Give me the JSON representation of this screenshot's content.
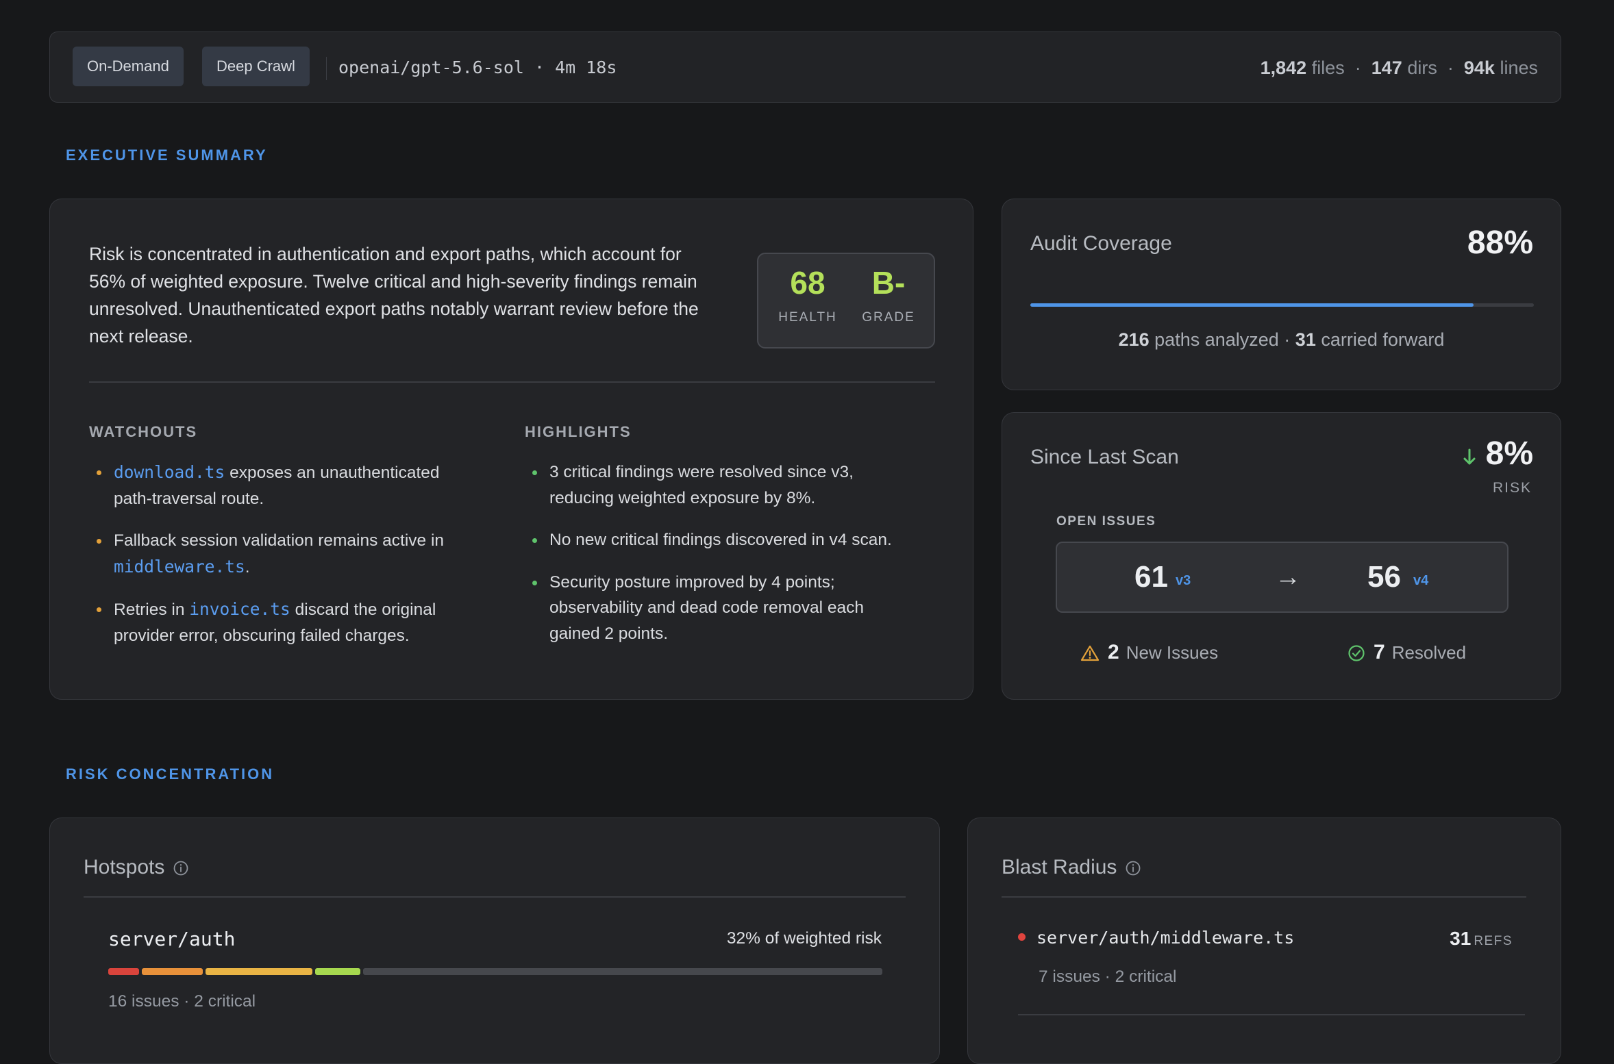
{
  "topbar": {
    "pill_1": "On-Demand",
    "pill_2": "Deep Crawl",
    "model": "openai/gpt-5.6-sol · 4m 18s",
    "files_count": "1,842",
    "files_label": "files",
    "dirs_count": "147",
    "dirs_label": "dirs",
    "lines_count": "94k",
    "lines_label": "lines",
    "separator": "·"
  },
  "sections": {
    "executive": "EXECUTIVE SUMMARY",
    "risk": "RISK CONCENTRATION"
  },
  "summary": {
    "text": "Risk is concentrated in authentication and export paths, which account for 56% of weighted exposure. Twelve critical and high-severity findings remain unresolved. Unauthenticated export paths notably warrant review before the next release.",
    "health_value": "68",
    "health_label": "HEALTH",
    "grade_value": "B-",
    "grade_label": "GRADE",
    "watchouts_title": "WATCHOUTS",
    "watchouts": [
      {
        "code": "download.ts",
        "post": " exposes an unauthenticated path-traversal route."
      },
      {
        "pre": "Fallback session validation remains active in ",
        "code": "middleware.ts",
        "post": "."
      },
      {
        "pre": "Retries in ",
        "code": "invoice.ts",
        "post": " discard the original provider error, obscuring failed charges."
      }
    ],
    "highlights_title": "HIGHLIGHTS",
    "highlights": [
      "3 critical findings were resolved since v3, reducing weighted exposure by 8%.",
      "No new critical findings discovered in v4 scan.",
      "Security posture improved by 4 points; observability and dead code removal each gained 2 points."
    ]
  },
  "coverage": {
    "title": "Audit Coverage",
    "percent": "88%",
    "fill_fraction": 0.88,
    "paths_count": "216",
    "paths_label": "paths analyzed ·",
    "forward_count": "31",
    "forward_label": "carried forward"
  },
  "scan": {
    "title": "Since Last Scan",
    "delta": "8%",
    "delta_label": "RISK",
    "open_label": "OPEN ISSUES",
    "prev_count": "61",
    "prev_version": "v3",
    "arrow": "→",
    "curr_count": "56",
    "curr_version": "v4",
    "new_count": "2",
    "new_label": "New Issues",
    "resolved_count": "7",
    "resolved_label": "Resolved"
  },
  "hotspots": {
    "title": "Hotspots",
    "item_name": "server/auth",
    "item_pct": "32% of weighted risk",
    "segments": [
      {
        "color": "#d9443c",
        "weight": 4
      },
      {
        "color": "#e8913a",
        "weight": 8
      },
      {
        "color": "#e9b445",
        "weight": 14
      },
      {
        "color": "#a6d84f",
        "weight": 6
      },
      {
        "color": "#46484d",
        "weight": 68
      }
    ],
    "item_meta": "16 issues · 2 critical"
  },
  "blast": {
    "title": "Blast Radius",
    "item_path": "server/auth/middleware.ts",
    "item_refs": "31",
    "refs_label": "REFS",
    "item_meta": "7 issues · 2 critical"
  },
  "colors": {
    "accent": "#4f95e8",
    "grade": "#b4e05a",
    "warning": "#e3a13a",
    "success": "#5fc46c",
    "critical": "#e0443e"
  }
}
